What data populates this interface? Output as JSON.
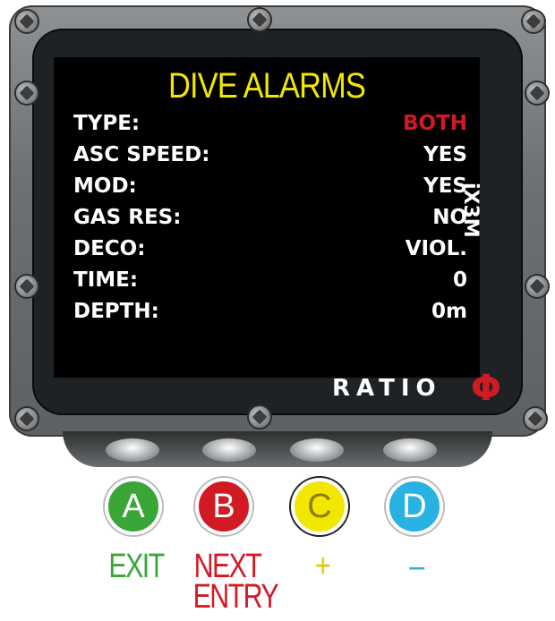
{
  "screen": {
    "title": "DIVE ALARMS",
    "rows": [
      {
        "label": "TYPE:",
        "value": "BOTH",
        "highlight": true
      },
      {
        "label": "ASC SPEED:",
        "value": "YES"
      },
      {
        "label": "MOD:",
        "value": "YES"
      },
      {
        "label": "GAS RES:",
        "value": "NO"
      },
      {
        "label": "DECO:",
        "value": "VIOL."
      },
      {
        "label": "TIME:",
        "value": "0"
      },
      {
        "label": "DEPTH:",
        "value": "0m"
      }
    ],
    "colors": {
      "title": "#f1e700",
      "highlight": "#d21a24",
      "text": "#ffffff",
      "background": "#000000"
    }
  },
  "device": {
    "model": "iX3M",
    "brand": "RATIO",
    "brand_symbol": "Φ"
  },
  "buttons": [
    {
      "letter": "A",
      "label": "EXIT",
      "color": "#3aa638"
    },
    {
      "letter": "B",
      "label_line1": "NEXT",
      "label_line2": "ENTRY",
      "color": "#d21a24"
    },
    {
      "letter": "C",
      "label": "+",
      "color": "#f1e700"
    },
    {
      "letter": "D",
      "label": "–",
      "color": "#27b2e3"
    }
  ]
}
